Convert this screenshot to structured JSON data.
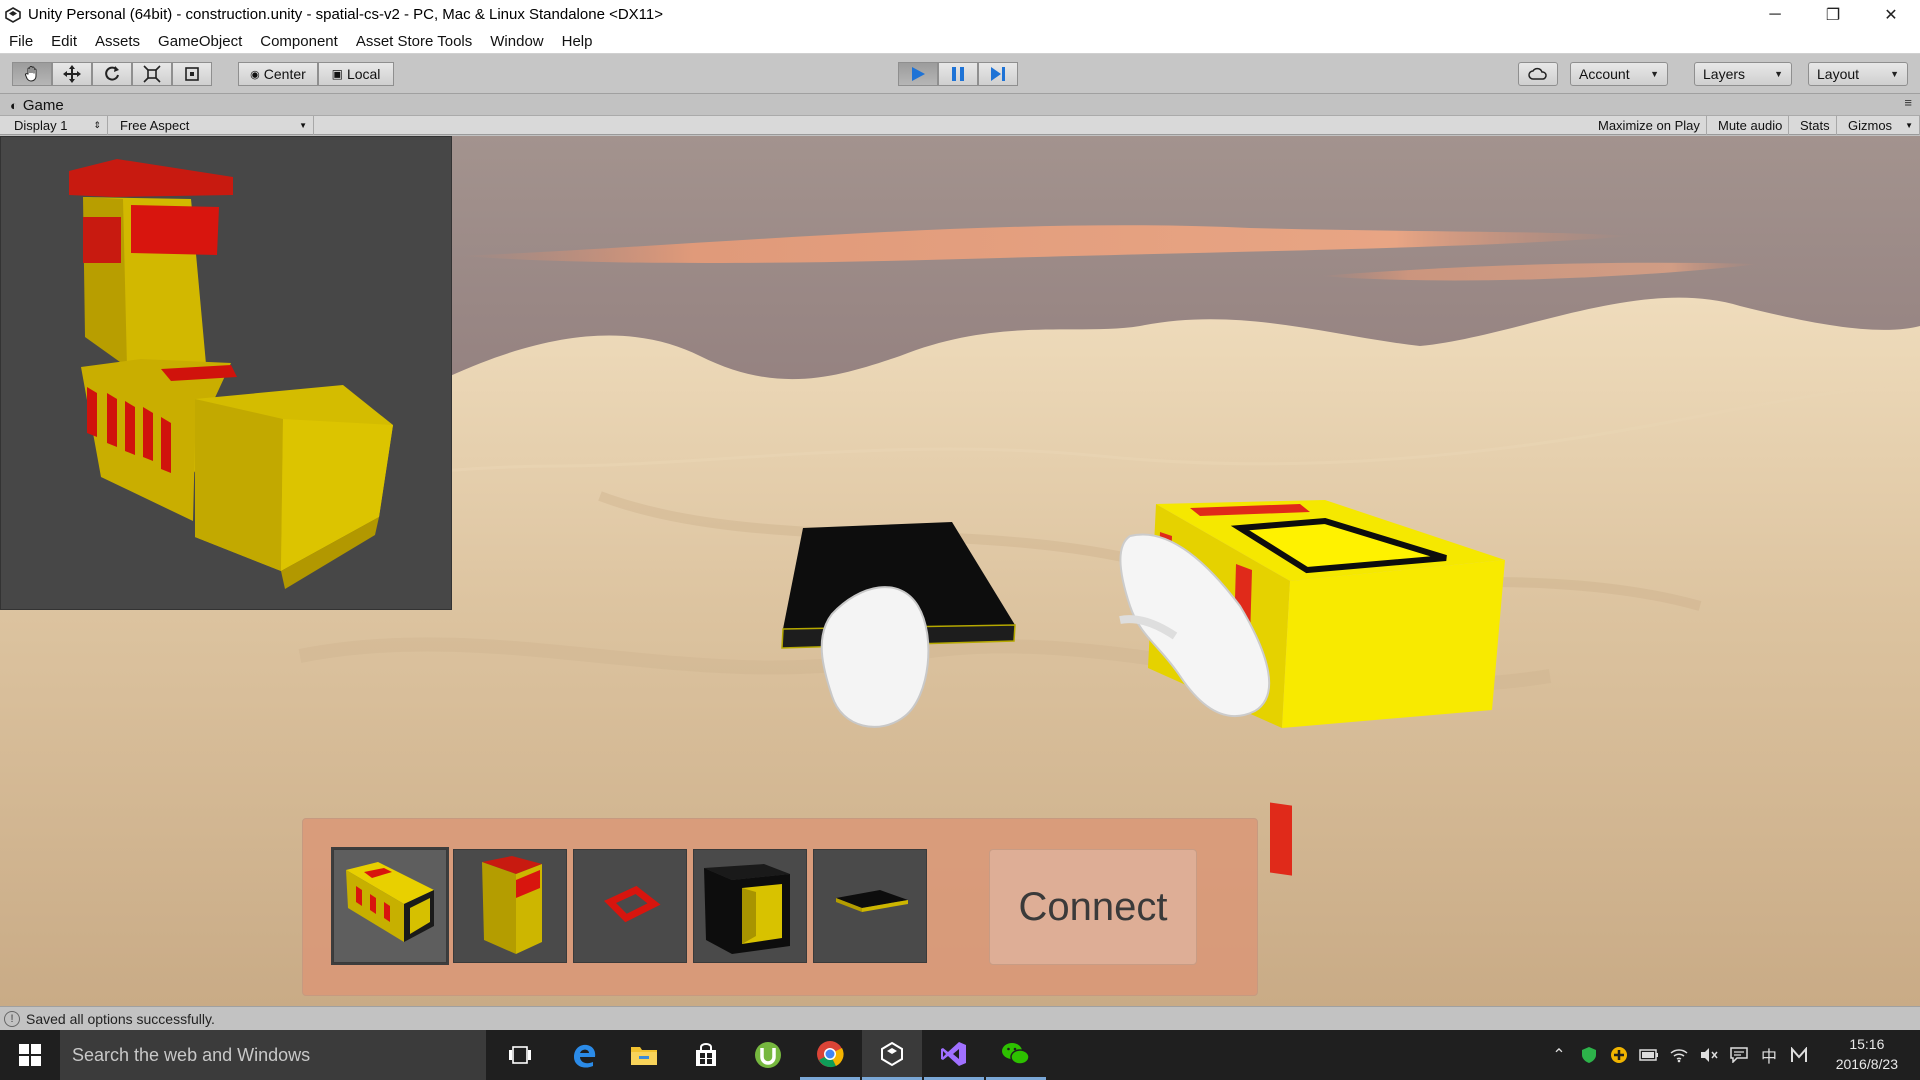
{
  "window": {
    "title": "Unity Personal (64bit) - construction.unity - spatial-cs-v2 - PC, Mac & Linux Standalone <DX11>",
    "controls": {
      "minimize": "─",
      "maximize": "❐",
      "close": "✕"
    }
  },
  "menu": [
    "File",
    "Edit",
    "Assets",
    "GameObject",
    "Component",
    "Asset Store Tools",
    "Window",
    "Help"
  ],
  "toolbar": {
    "pivot": "Center",
    "space": "Local",
    "play_state": "playing",
    "account": "Account",
    "layers": "Layers",
    "layout": "Layout"
  },
  "game_panel": {
    "tab": "Game",
    "display": "Display 1",
    "aspect": "Free Aspect",
    "maximize_on_play": "Maximize on Play",
    "mute_audio": "Mute audio",
    "stats": "Stats",
    "gizmos": "Gizmos"
  },
  "scene": {
    "colors": {
      "sand": "#d9c3a0",
      "sky": "#8f7a78",
      "block_yellow": "#f2e200",
      "block_red": "#e02a1a",
      "block_black": "#0d0d0d",
      "preview_bg": "#474747"
    }
  },
  "palette": {
    "items": [
      "bench-block",
      "tall-block",
      "red-frame",
      "hollow-block",
      "flat-plate"
    ],
    "selected_index": 0,
    "connect_label": "Connect"
  },
  "status": {
    "message": "Saved all options successfully."
  },
  "taskbar": {
    "search_placeholder": "Search the web and Windows",
    "apps": [
      "task-view",
      "edge",
      "file-explorer",
      "store",
      "utorrent",
      "chrome",
      "unity",
      "visual-studio",
      "wechat"
    ],
    "tray_input": "中",
    "time": "15:16",
    "date": "2016/8/23"
  }
}
